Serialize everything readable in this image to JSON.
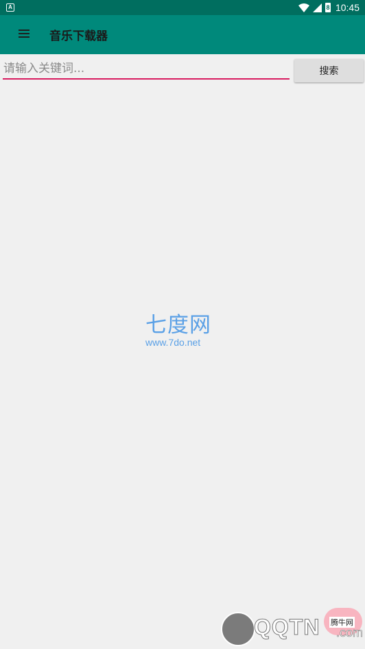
{
  "status_bar": {
    "left_icon": "A",
    "battery_level": "8",
    "time": "10:45"
  },
  "app_bar": {
    "title": "音乐下载器"
  },
  "search": {
    "placeholder": "请输入关键词...",
    "button_label": "搜索"
  },
  "watermark": {
    "center_cn": "七度网",
    "center_url": "www.7do.net",
    "bottom_brand": "QQTN",
    "bottom_domain": ".com",
    "bottom_badge": "腾牛网"
  },
  "colors": {
    "app_bar": "#00897b",
    "status_bar": "#006e5f",
    "input_underline": "#d81b60",
    "watermark_blue": "#5aa0e6"
  }
}
